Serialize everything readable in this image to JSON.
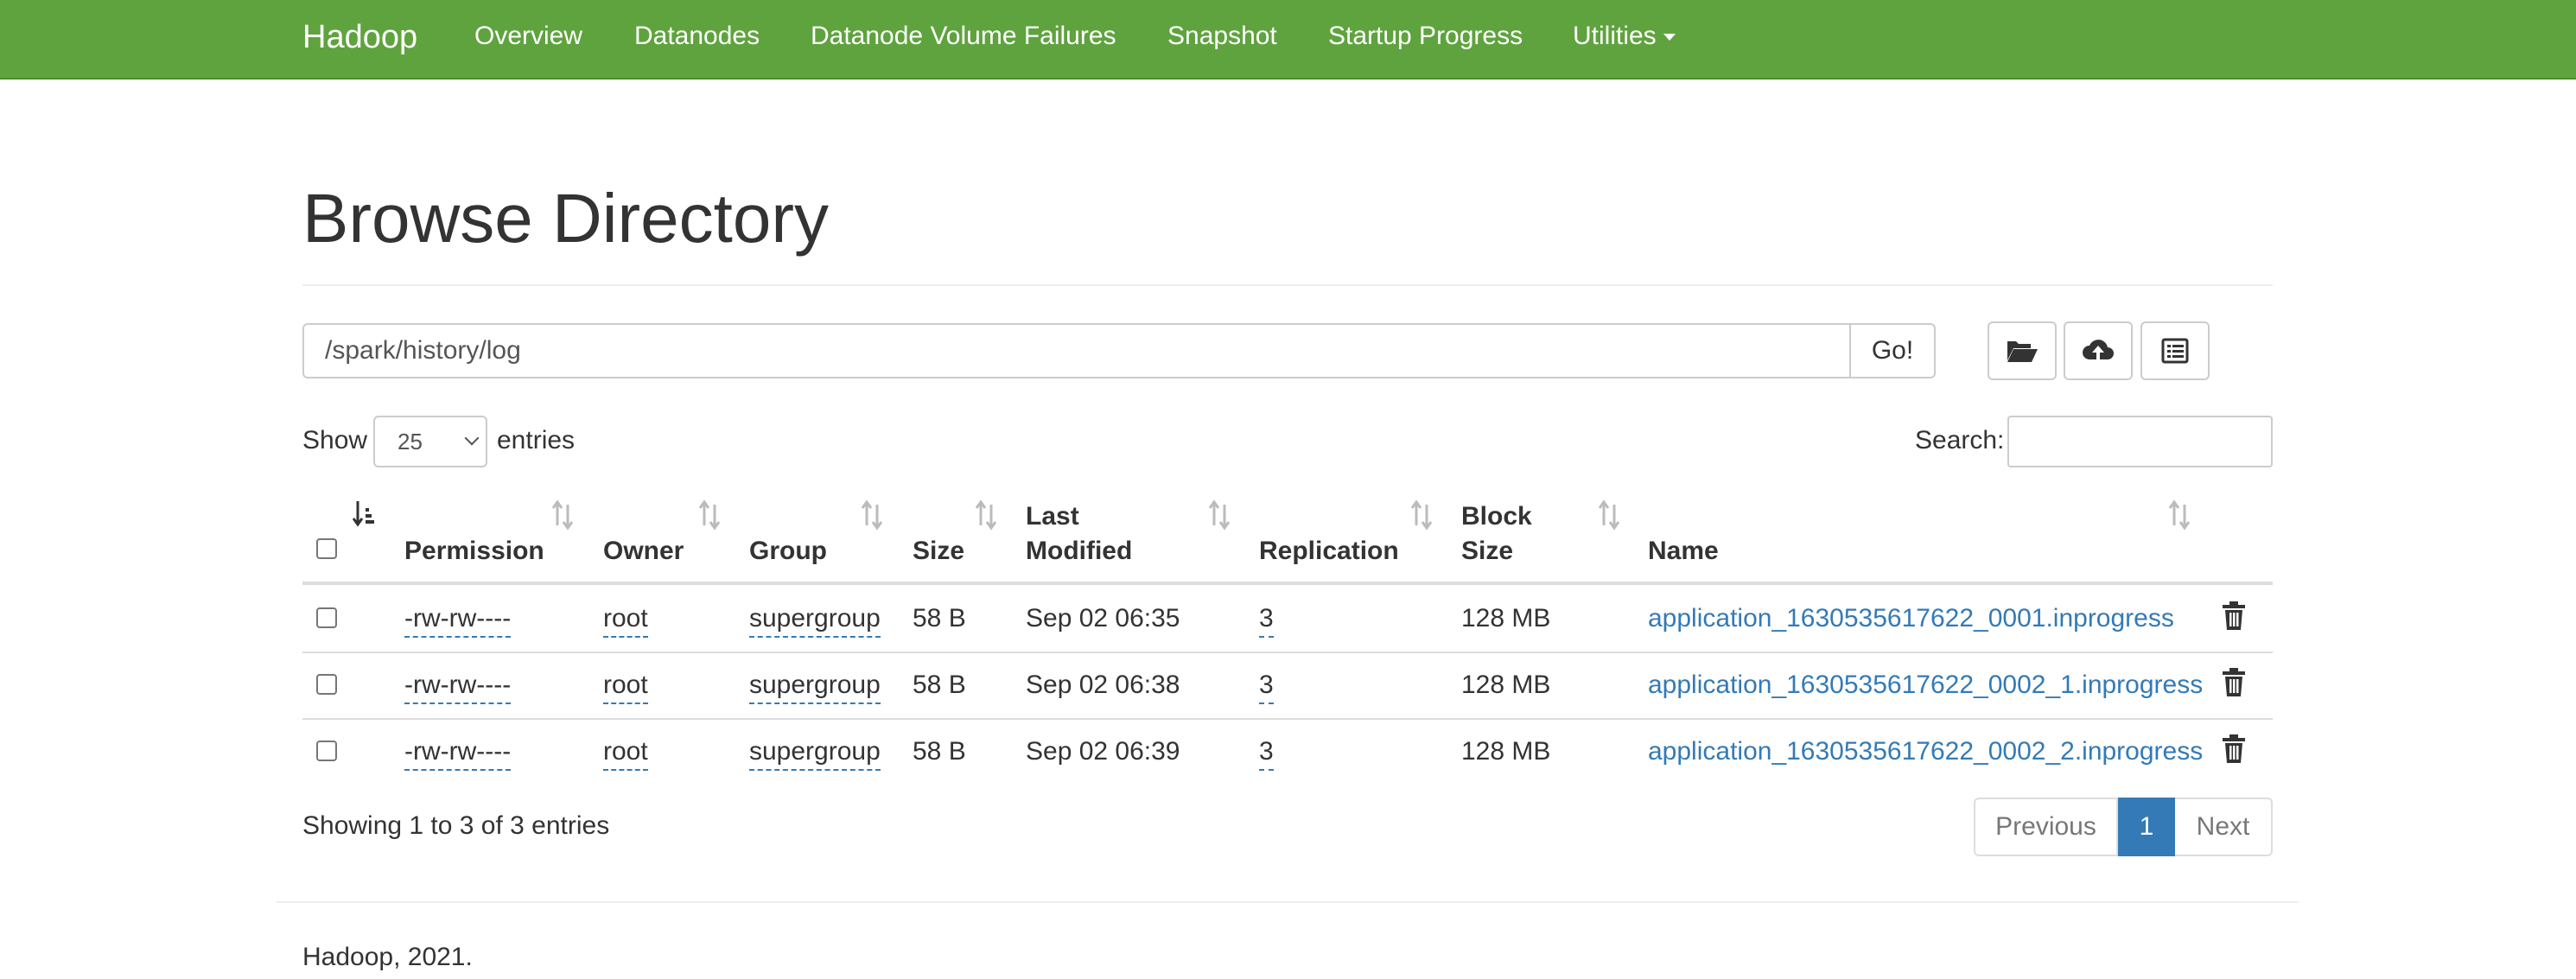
{
  "navbar": {
    "brand": "Hadoop",
    "items": [
      "Overview",
      "Datanodes",
      "Datanode Volume Failures",
      "Snapshot",
      "Startup Progress",
      "Utilities"
    ]
  },
  "page": {
    "title": "Browse Directory"
  },
  "path": {
    "value": "/spark/history/log",
    "go_label": "Go!"
  },
  "toolbar": {
    "icons": [
      "folder-open-icon",
      "cloud-upload-icon",
      "list-alt-icon"
    ]
  },
  "length": {
    "show_label": "Show",
    "selected": "25",
    "entries_label": "entries"
  },
  "search": {
    "label": "Search:",
    "value": ""
  },
  "table": {
    "headers": [
      "Permission",
      "Owner",
      "Group",
      "Size",
      "Last",
      "Modified",
      "Replication",
      "Block",
      "Size",
      "Name"
    ],
    "rows": [
      {
        "permission": "-rw-rw----",
        "owner": "root",
        "group": "supergroup",
        "size": "58 B",
        "modified": "Sep 02 06:35",
        "replication": "3",
        "block_size": "128 MB",
        "name": "application_1630535617622_0001.inprogress"
      },
      {
        "permission": "-rw-rw----",
        "owner": "root",
        "group": "supergroup",
        "size": "58 B",
        "modified": "Sep 02 06:38",
        "replication": "3",
        "block_size": "128 MB",
        "name": "application_1630535617622_0002_1.inprogress"
      },
      {
        "permission": "-rw-rw----",
        "owner": "root",
        "group": "supergroup",
        "size": "58 B",
        "modified": "Sep 02 06:39",
        "replication": "3",
        "block_size": "128 MB",
        "name": "application_1630535617622_0002_2.inprogress"
      }
    ]
  },
  "info": {
    "text": "Showing 1 to 3 of 3 entries"
  },
  "pagination": {
    "previous": "Previous",
    "current": "1",
    "next": "Next"
  },
  "footer": {
    "text": "Hadoop, 2021."
  },
  "colors": {
    "navbar": "#5fa33e",
    "link": "#337ab7",
    "active_page": "#337ab7"
  }
}
